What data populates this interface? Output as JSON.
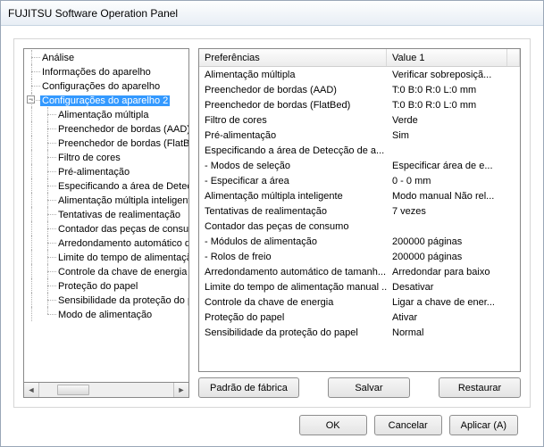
{
  "window": {
    "title": "FUJITSU Software Operation Panel"
  },
  "tree": {
    "items": [
      {
        "label": "Análise",
        "depth": 1
      },
      {
        "label": "Informações do aparelho",
        "depth": 1
      },
      {
        "label": "Configurações do aparelho",
        "depth": 1
      },
      {
        "label": "Configurações do aparelho 2",
        "depth": 1,
        "expanded": true,
        "selected": true
      },
      {
        "label": "Alimentação múltipla",
        "depth": 2
      },
      {
        "label": "Preenchedor de bordas (AAD)",
        "depth": 2
      },
      {
        "label": "Preenchedor de bordas (FlatBed)",
        "depth": 2
      },
      {
        "label": "Filtro de cores",
        "depth": 2
      },
      {
        "label": "Pré-alimentação",
        "depth": 2
      },
      {
        "label": "Especificando a área de Detecção de alimentação múltipla",
        "depth": 2
      },
      {
        "label": "Alimentação múltipla inteligente",
        "depth": 2
      },
      {
        "label": "Tentativas de realimentação",
        "depth": 2
      },
      {
        "label": "Contador das peças de consumo",
        "depth": 2
      },
      {
        "label": "Arredondamento automático do tamanho",
        "depth": 2
      },
      {
        "label": "Limite do tempo de alimentação manual",
        "depth": 2
      },
      {
        "label": "Controle da chave de energia",
        "depth": 2
      },
      {
        "label": "Proteção do papel",
        "depth": 2
      },
      {
        "label": "Sensibilidade da proteção do papel",
        "depth": 2
      },
      {
        "label": "Modo de alimentação",
        "depth": 2,
        "last": true
      }
    ]
  },
  "list": {
    "header_pref": "Preferências",
    "header_val": "Value 1",
    "rows": [
      {
        "pref": "Alimentação múltipla",
        "val": "Verificar sobreposiçã..."
      },
      {
        "pref": "Preenchedor de bordas (AAD)",
        "val": "T:0  B:0  R:0  L:0 mm"
      },
      {
        "pref": "Preenchedor de bordas (FlatBed)",
        "val": "T:0  B:0  R:0  L:0 mm"
      },
      {
        "pref": "Filtro de cores",
        "val": "Verde"
      },
      {
        "pref": "Pré-alimentação",
        "val": "Sim"
      },
      {
        "pref": "Especificando a área de Detecção de a...",
        "val": ""
      },
      {
        "pref": " - Modos de seleção",
        "val": "Especificar área de e..."
      },
      {
        "pref": " - Especificar a área",
        "val": "0 - 0 mm"
      },
      {
        "pref": "Alimentação múltipla inteligente",
        "val": "Modo manual  Não rel..."
      },
      {
        "pref": "Tentativas de realimentação",
        "val": "7 vezes"
      },
      {
        "pref": "Contador das peças de consumo",
        "val": ""
      },
      {
        "pref": "- Módulos de alimentação",
        "val": "200000 páginas"
      },
      {
        "pref": "- Rolos de freio",
        "val": "200000 páginas"
      },
      {
        "pref": "Arredondamento automático de tamanh...",
        "val": "Arredondar para baixo"
      },
      {
        "pref": "Limite do tempo de alimentação manual ...",
        "val": "Desativar"
      },
      {
        "pref": "Controle da chave de energia",
        "val": "Ligar a chave de ener..."
      },
      {
        "pref": "Proteção do papel",
        "val": "Ativar"
      },
      {
        "pref": "Sensibilidade da proteção do papel",
        "val": "Normal"
      }
    ]
  },
  "buttons": {
    "factory": "Padrão de fábrica",
    "save": "Salvar",
    "restore": "Restaurar",
    "ok": "OK",
    "cancel": "Cancelar",
    "apply": "Aplicar (A)"
  }
}
